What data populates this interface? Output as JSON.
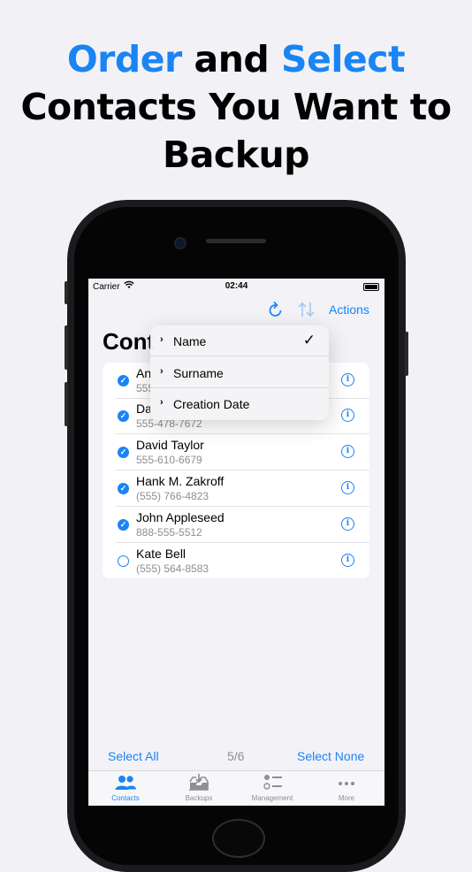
{
  "headline": {
    "line1_accent1": "Order",
    "line1_mid": " and ",
    "line1_accent2": "Select",
    "line2": "Contacts You Want to",
    "line3": "Backup"
  },
  "colors": {
    "accent": "#1a84f5",
    "secondary_text": "#8e8e93"
  },
  "status_bar": {
    "carrier": "Carrier",
    "time": "02:44"
  },
  "nav": {
    "refresh_icon": "refresh-icon",
    "sort_icon": "sort-arrows-icon",
    "actions_label": "Actions"
  },
  "page_title": "Cont",
  "sort_menu": {
    "items": [
      {
        "label": "Name",
        "selected": true
      },
      {
        "label": "Surname",
        "selected": false
      },
      {
        "label": "Creation Date",
        "selected": false
      }
    ]
  },
  "contacts": [
    {
      "name": "An",
      "phone": "555",
      "selected": true
    },
    {
      "name": "Da",
      "phone": "555-478-7672",
      "selected": true
    },
    {
      "name": "David Taylor",
      "phone": "555-610-6679",
      "selected": true
    },
    {
      "name": "Hank M. Zakroff",
      "phone": "(555) 766-4823",
      "selected": true
    },
    {
      "name": "John Appleseed",
      "phone": "888-555-5512",
      "selected": true
    },
    {
      "name": "Kate Bell",
      "phone": "(555) 564-8583",
      "selected": false
    }
  ],
  "selection_bar": {
    "select_all": "Select All",
    "count": "5/6",
    "select_none": "Select None"
  },
  "tabs": [
    {
      "label": "Contacts",
      "icon": "contacts-icon",
      "active": true
    },
    {
      "label": "Backups",
      "icon": "backups-tray-icon",
      "active": false
    },
    {
      "label": "Management",
      "icon": "management-list-icon",
      "active": false
    },
    {
      "label": "More",
      "icon": "more-dots-icon",
      "active": false
    }
  ]
}
